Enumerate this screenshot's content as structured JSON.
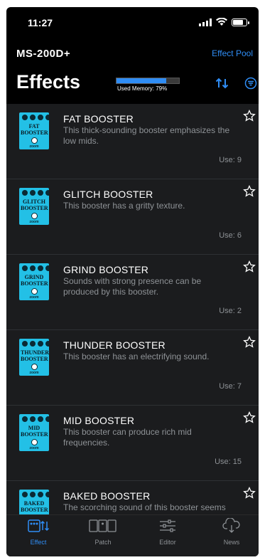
{
  "status": {
    "time": "11:27"
  },
  "header": {
    "device": "MS-200D+",
    "effect_pool": "Effect Pool",
    "title": "Effects",
    "memory_label": "Used Memory: 79%",
    "memory_percent": 79
  },
  "effects": [
    {
      "name": "FAT BOOSTER",
      "desc": "This thick-sounding booster emphasizes the low mids.",
      "use": "Use: 9",
      "pedal_text": "FAT BOOSTER"
    },
    {
      "name": "GLITCH BOOSTER",
      "desc": "This booster has a gritty texture.",
      "use": "Use: 6",
      "pedal_text": "GLITCH BOOSTER"
    },
    {
      "name": "GRIND BOOSTER",
      "desc": "Sounds with strong presence can be produced by this booster.",
      "use": "Use: 2",
      "pedal_text": "GRIND BOOSTER"
    },
    {
      "name": "THUNDER BOOSTER",
      "desc": "This booster has an electrifying sound.",
      "use": "Use: 7",
      "pedal_text": "THUNDER BOOSTER"
    },
    {
      "name": "MID BOOSTER",
      "desc": "This booster can produce rich mid frequencies.",
      "use": "Use: 15",
      "pedal_text": "MID BOOSTER"
    },
    {
      "name": "BAKED BOOSTER",
      "desc": "The scorching sound of this booster seems about to catch fire.",
      "use": "",
      "pedal_text": "BAKED BOOSTER"
    }
  ],
  "pedal_brand": "zoom",
  "tabs": [
    {
      "label": "Effect",
      "icon": "effect-icon"
    },
    {
      "label": "Patch",
      "icon": "patch-icon"
    },
    {
      "label": "Editor",
      "icon": "editor-icon"
    },
    {
      "label": "News",
      "icon": "news-icon"
    }
  ],
  "colors": {
    "accent": "#2f8df5",
    "pedal": "#23c0e6",
    "background": "#1b1c1e"
  }
}
